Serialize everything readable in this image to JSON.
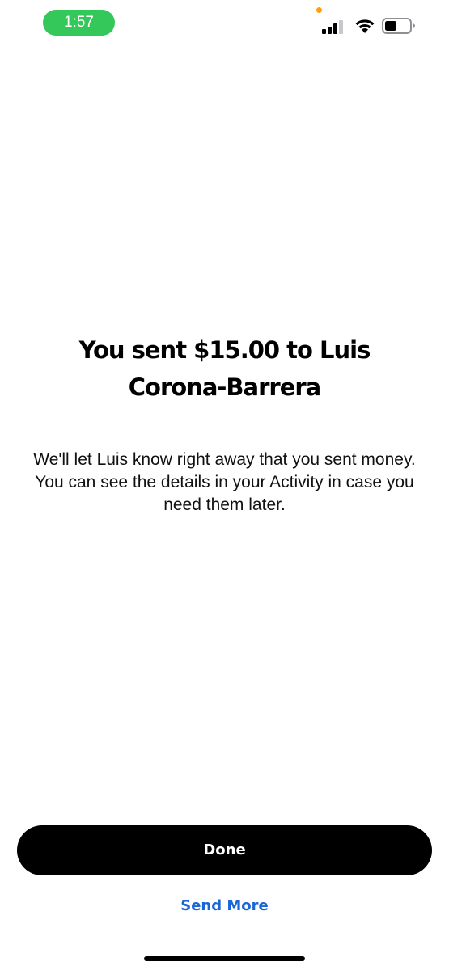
{
  "status_bar": {
    "time": "1:57",
    "icons": [
      "signal-icon",
      "wifi-icon",
      "battery-icon"
    ],
    "accent_color": "#34c759"
  },
  "confirmation": {
    "title": "You sent $15.00 to Luis Corona-Barrera",
    "message": "We'll let Luis know right away that you sent money. You can see the details in your Activity in case you need them later."
  },
  "actions": {
    "done_label": "Done",
    "send_more_label": "Send More",
    "link_color": "#1a66d6"
  }
}
